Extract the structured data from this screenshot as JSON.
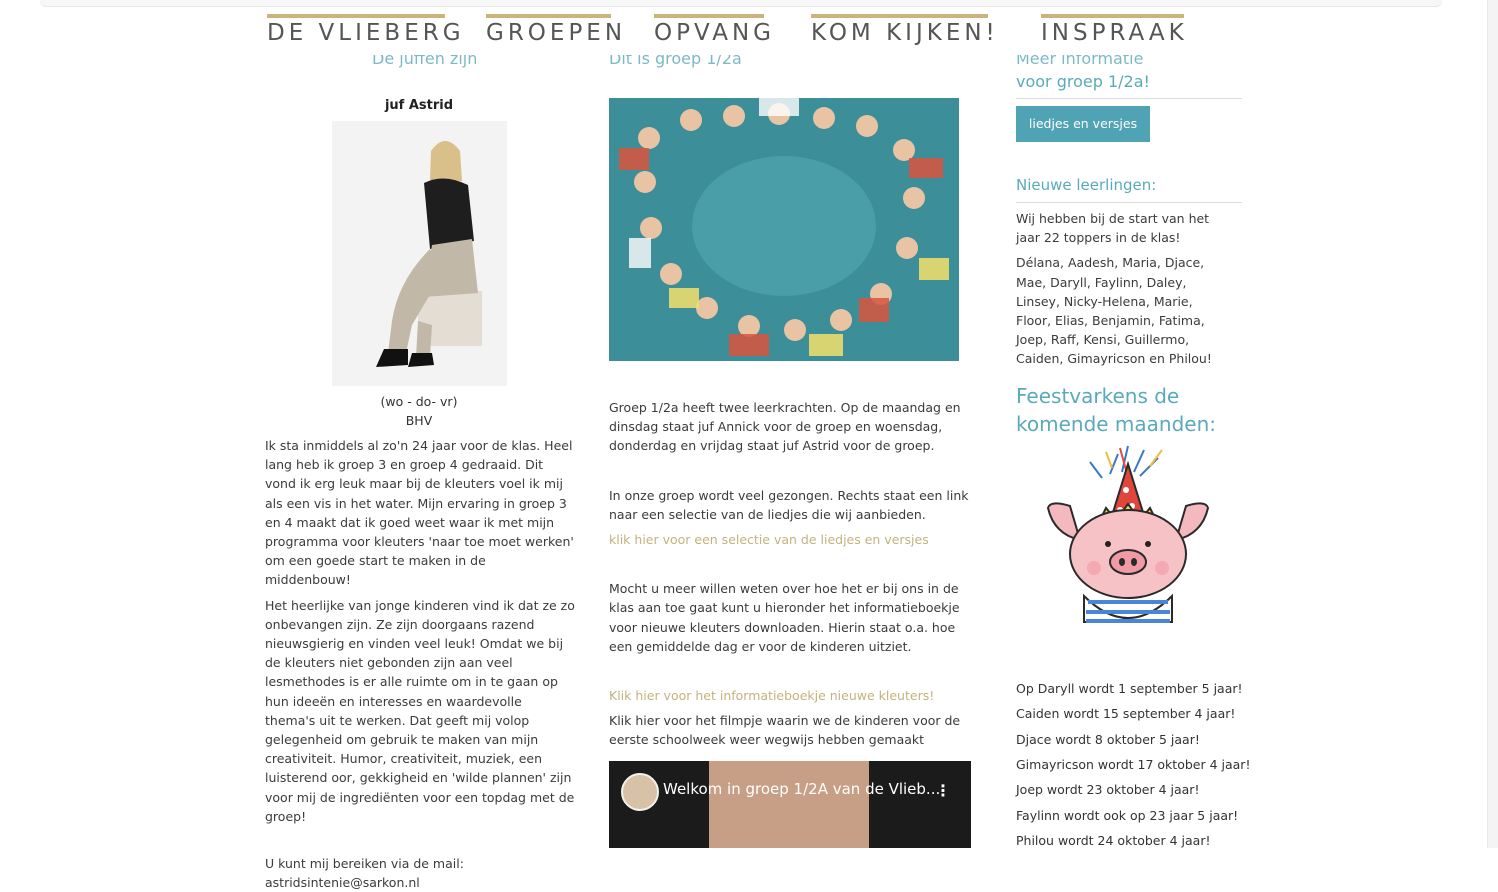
{
  "nav": {
    "items": [
      {
        "label": "DE VLIEBERG"
      },
      {
        "label": "GROEPEN"
      },
      {
        "label": "OPVANG"
      },
      {
        "label": "KOM KIJKEN!"
      },
      {
        "label": "INSPRAAK"
      }
    ]
  },
  "left": {
    "cut_heading": "De juffen zijn",
    "teacher_name": "juf Astrid",
    "days": "(wo - do- vr)",
    "role": "BHV",
    "para1": "Ik sta inmiddels al zo'n 24 jaar voor de klas. Heel lang heb ik groep 3 en groep 4 gedraaid. Dit vond ik erg leuk maar bij de kleuters voel ik mij als een vis in het water. Mijn ervaring in groep 3 en 4 maakt dat ik goed weet waar ik met mijn programma voor kleuters 'naar toe moet werken' om een goede start te maken in de middenbouw!",
    "para2": "Het heerlijke van jonge kinderen vind ik dat ze zo onbevangen zijn. Ze zijn doorgaans razend nieuwsgierig en vinden veel leuk! Omdat we bij de kleuters niet gebonden zijn aan veel lesmethodes is er alle ruimte om in te gaan op hun ideeën en interesses en waardevolle thema's uit te werken. Dat geeft mij volop gelegenheid om gebruik te maken van mijn creativiteit. Humor, creativiteit, muziek, een luisterend oor, gekkigheid en 'wilde plannen' zijn voor mij de ingrediënten voor een topdag met de groep!",
    "contact_line": "U kunt mij bereiken via de mail:",
    "email": "astridsintenie@sarkon.nl"
  },
  "middle": {
    "cut_heading": "Dit is groep 1/2a",
    "para1": "Groep 1/2a heeft twee leerkrachten. Op de maandag en dinsdag staat juf Annick voor de groep en woensdag, donderdag en vrijdag staat juf Astrid voor de groep.",
    "para2": "In onze groep wordt veel gezongen. Rechts staat een link naar een selectie van de liedjes die wij aanbieden.",
    "link1": "klik hier voor een selectie van de liedjes en versjes",
    "para3": "Mocht u meer willen weten over hoe het er bij ons in de klas aan toe gaat kunt u hieronder het informatieboekje voor nieuwe kleuters downloaden. Hierin staat o.a. hoe een gemiddelde dag er voor de kinderen uitziet.",
    "link2": "Klik hier voor het informatieboekje nieuwe kleuters!",
    "para4": "Klik hier voor het filmpje waarin we de kinderen voor de eerste schoolweek weer wegwijs hebben gemaakt",
    "video_title": "Welkom in groep 1/2A van de Vlieb...",
    "video_menu": "⋮"
  },
  "right": {
    "cut_heading": "Meer informatie",
    "heading_tail": "voor groep 1/2a!",
    "button_label": "liedjes en versjes",
    "new_heading": "Nieuwe leerlingen:",
    "new_intro": "Wij hebben bij de start van het jaar 22 toppers in de klas!",
    "new_names": "Délana, Aadesh, Maria, Djace, Mae, Daryll, Faylinn, Daley, Linsey, Nicky-Helena, Marie, Floor, Elias, Benjamin, Fatima, Joep, Raff, Kensi, Guillermo, Caiden, Gimayricson en Philou!",
    "birthday_heading": "Feestvarkens de komende maanden:",
    "birthdays": [
      "Op Daryll wordt 1 september 5 jaar!",
      "Caiden wordt 15 september 4 jaar!",
      "Djace wordt 8 oktober 5 jaar!",
      "Gimayricson wordt 17 oktober 4 jaar!",
      "Joep wordt 23 oktober 4 jaar!",
      "Faylinn wordt ook op 23 jaar 5 jaar!",
      "Philou wordt 24 oktober 4 jaar!"
    ]
  },
  "colors": {
    "nav_accent": "#c9b57c",
    "heading_blue": "#5aaabb",
    "button_bg": "#4fa3b5",
    "link_gold": "#c4b27e"
  }
}
